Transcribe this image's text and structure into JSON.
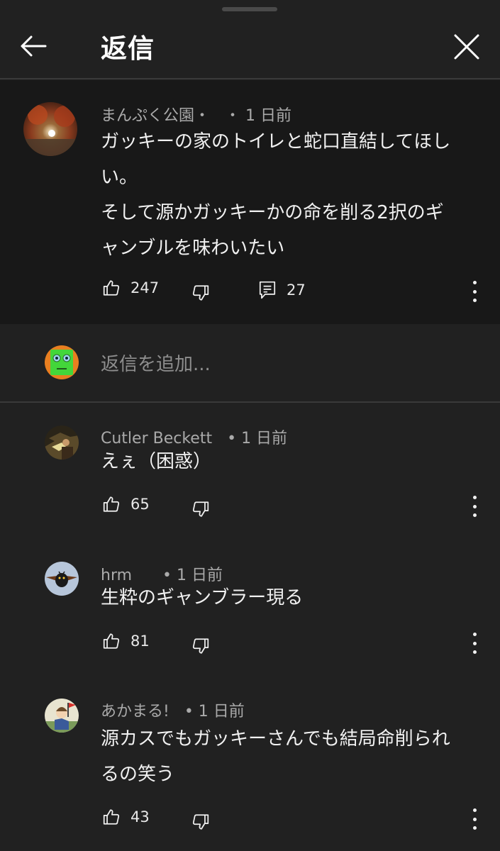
{
  "header": {
    "title": "返信"
  },
  "parent_comment": {
    "author": "まんぷく公園・",
    "time": "・ 1 日前",
    "lines": [
      "ガッキーの家のトイレと蛇口直結してほし",
      "い。",
      "そして源かガッキーかの命を削る2択のギ",
      "ャンブルを味わいたい"
    ],
    "likes": "247",
    "replies": "27"
  },
  "add_reply": {
    "placeholder": "返信を追加..."
  },
  "replies": [
    {
      "author": "Cutler Beckett",
      "time": "• 1 日前",
      "lines": [
        "えぇ（困惑）"
      ],
      "likes": "65"
    },
    {
      "author": "hrm ",
      "time": "• 1 日前",
      "lines": [
        "生粋のギャンブラー現る"
      ],
      "likes": "81"
    },
    {
      "author": "あかまる!",
      "time": "• 1 日前",
      "lines": [
        "源カスでもガッキーさんでも結局命削られ",
        "るの笑う"
      ],
      "likes": "43"
    }
  ],
  "icons": {
    "back": "arrow-left-icon",
    "close": "close-icon",
    "like": "thumbs-up-icon",
    "dislike": "thumbs-down-icon",
    "reply": "comment-icon",
    "more": "more-vertical-icon"
  },
  "colors": {
    "background": "#212121",
    "parent_background": "#181818",
    "text": "#f1f1f1",
    "secondary_text": "#aaaaaa"
  }
}
